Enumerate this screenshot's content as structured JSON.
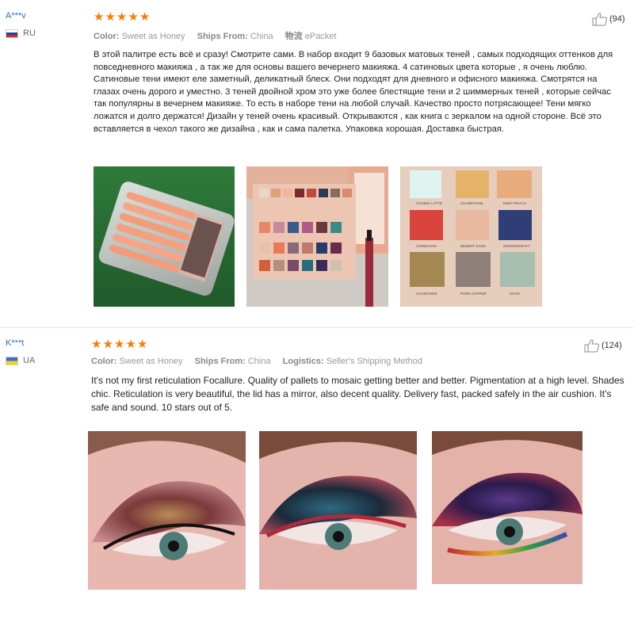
{
  "reviews": [
    {
      "user": "A***v",
      "country": "RU",
      "rating": 5,
      "meta": {
        "color_label": "Color:",
        "color_value": "Sweet as Honey",
        "ships_label": "Ships From:",
        "ships_value": "China",
        "logistics_label": "物流",
        "logistics_value": "ePacket"
      },
      "likes": "(94)",
      "text": "В этой палитре есть всё и сразу! Смотрите сами. В набор входит 9 базовых матовых теней , самых подходящих оттенков для повседневного макияжа , а так же для основы вашего вечернего макияжа. 4 сатиновых цвета которые , я очень люблю. Сатиновые тени имеют еле заметный, деликатный блеск. Они подходят для дневного и офисного макияжа. Смотрятся на глазах очень дорого и уместно. 3 теней двойной хром это уже более блестящие тени и 2 шиммерных теней , которые сейчас так популярны в вечернем макияже. То есть в наборе тени на любой случай. Качество просто потрясающее! Тени мягко ложатся и долго держатся! Дизайн у теней очень красивый. Открываются , как книга с зеркалом на одной стороне. Всё это вставляется в чехол такого же дизайна , как и сама палетка. Упаковка хорошая. Доставка быстрая.",
      "photos": {
        "p1": "brush-set-in-packaging-photo",
        "p2": "palette-open-with-mirror-photo",
        "p3_labels": [
          "COSMIC LATTE",
          "CHAMPAGNE",
          "DEEP PEACH",
          "CORDOVAN",
          "DESERT SAND",
          "WISDOMCRAFT",
          "CHAMOISEE",
          "PURE COPPER",
          "KHAKI"
        ]
      }
    },
    {
      "user": "K***t",
      "country": "UA",
      "rating": 5,
      "meta": {
        "color_label": "Color:",
        "color_value": "Sweet as Honey",
        "ships_label": "Ships From:",
        "ships_value": "China",
        "logistics_label": "Logistics:",
        "logistics_value": "Seller's Shipping Method"
      },
      "likes": "(124)",
      "text": "It's not my first reticulation Focallure. Quality of pallets to mosaic getting better and better. Pigmentation at a high level. Shades chic. Reticulation is very beautiful, the lid has a mirror, also decent quality. Delivery fast, packed safely in the air cushion. It's safe and sound. 10 stars out of 5.",
      "photos": {
        "p1": "eye-makeup-gold-photo",
        "p2": "eye-makeup-teal-red-photo",
        "p3": "eye-makeup-purple-rainbow-photo"
      }
    }
  ],
  "colors": {
    "star": "#ff7a00",
    "username": "#2c6fb7",
    "meta": "#888888"
  }
}
